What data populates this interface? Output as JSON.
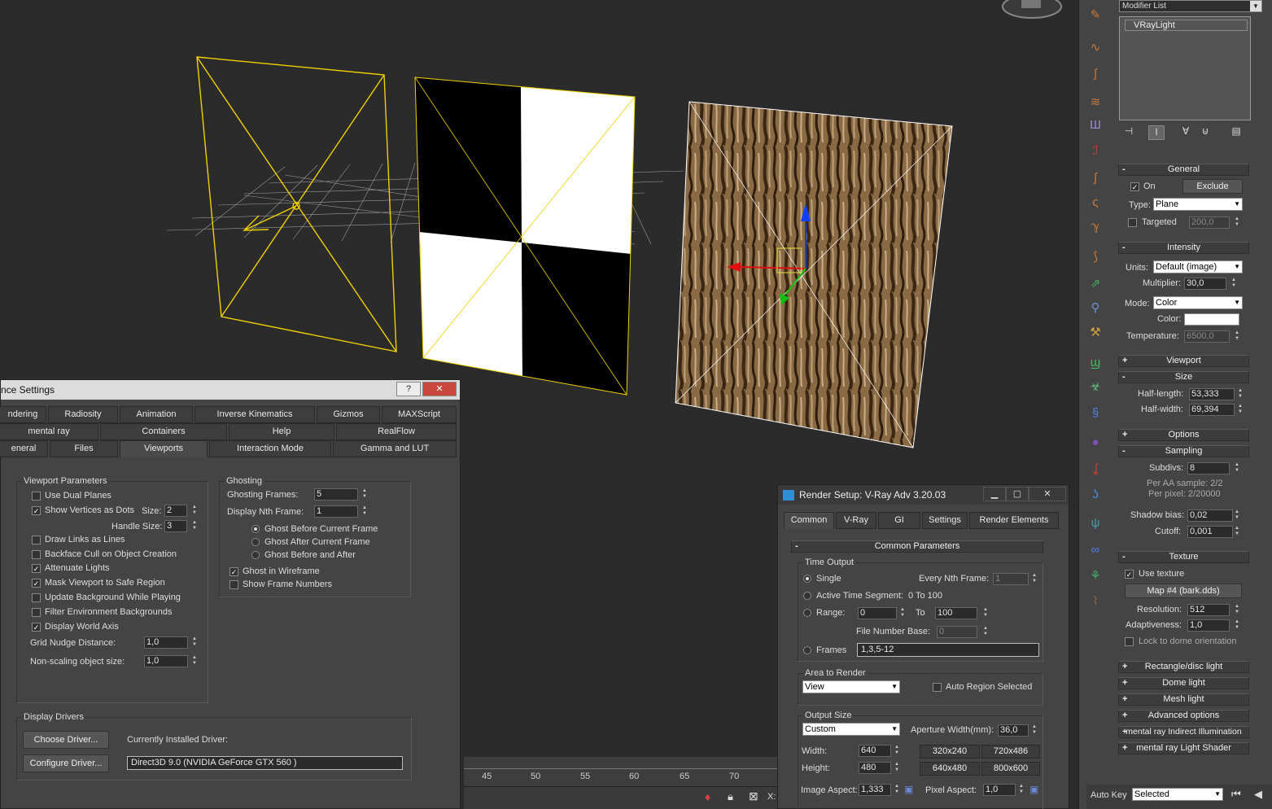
{
  "prefs": {
    "title": "nce Settings",
    "tabs_row1": [
      "ndering",
      "Radiosity",
      "Animation",
      "Inverse Kinematics",
      "Gizmos",
      "MAXScript"
    ],
    "tabs_row2": [
      "mental ray",
      "Containers",
      "Help",
      "RealFlow"
    ],
    "tabs_row3": [
      "eneral",
      "Files",
      "Viewports",
      "Interaction Mode",
      "Gamma and LUT"
    ],
    "viewport_params": {
      "title": "Viewport Parameters",
      "use_dual_planes": "Use Dual Planes",
      "show_vertices": "Show Vertices as Dots",
      "size_label": "Size:",
      "size_value": "2",
      "handle_size_label": "Handle Size:",
      "handle_size_value": "3",
      "draw_links": "Draw Links as Lines",
      "backface_cull": "Backface Cull on Object Creation",
      "attenuate_lights": "Attenuate Lights",
      "mask_viewport": "Mask Viewport to Safe Region",
      "update_background": "Update Background While Playing",
      "filter_env": "Filter Environment Backgrounds",
      "display_world_axis": "Display World Axis",
      "grid_nudge_label": "Grid Nudge Distance:",
      "grid_nudge_value": "1,0",
      "non_scaling_label": "Non-scaling object size:",
      "non_scaling_value": "1,0"
    },
    "ghosting": {
      "title": "Ghosting",
      "frames_label": "Ghosting Frames:",
      "frames_value": "5",
      "nth_label": "Display Nth Frame:",
      "nth_value": "1",
      "before": "Ghost Before Current Frame",
      "after": "Ghost After Current Frame",
      "both": "Ghost Before and After",
      "wireframe": "Ghost in Wireframe",
      "show_numbers": "Show Frame Numbers"
    },
    "display_drivers": {
      "title": "Display Drivers",
      "choose": "Choose Driver...",
      "configure": "Configure Driver...",
      "installed_label": "Currently Installed Driver:",
      "installed_value": "Direct3D 9.0 (NVIDIA GeForce GTX 560 )"
    }
  },
  "render": {
    "title": "Render Setup: V-Ray Adv 3.20.03",
    "tabs": [
      "Common",
      "V-Ray",
      "GI",
      "Settings",
      "Render Elements"
    ],
    "rollout": "Common Parameters",
    "time_output": {
      "title": "Time Output",
      "single": "Single",
      "every_nth": "Every Nth Frame:",
      "every_nth_value": "1",
      "active_segment": "Active Time Segment:",
      "active_segment_value": "0 To 100",
      "range": "Range:",
      "range_from": "0",
      "to": "To",
      "range_to": "100",
      "file_number_base": "File Number Base:",
      "file_number_base_value": "0",
      "frames": "Frames",
      "frames_value": "1,3,5-12"
    },
    "area": {
      "title": "Area to Render",
      "value": "View",
      "auto_region": "Auto Region Selected"
    },
    "output_size": {
      "title": "Output Size",
      "preset": "Custom",
      "aperture_label": "Aperture Width(mm):",
      "aperture_value": "36,0",
      "width_label": "Width:",
      "width_value": "640",
      "height_label": "Height:",
      "height_value": "480",
      "presets": [
        "320x240",
        "720x486",
        "640x480",
        "800x600"
      ],
      "image_aspect_label": "Image Aspect:",
      "image_aspect_value": "1,333",
      "pixel_aspect_label": "Pixel Aspect:",
      "pixel_aspect_value": "1,0"
    }
  },
  "cmdpanel": {
    "modifier_list": "Modifier List",
    "stack_item": "VRayLight",
    "general": {
      "title": "General",
      "on": "On",
      "exclude": "Exclude",
      "type_label": "Type:",
      "type_value": "Plane",
      "targeted": "Targeted",
      "targeted_value": "200,0"
    },
    "intensity": {
      "title": "Intensity",
      "units_label": "Units:",
      "units_value": "Default (image)",
      "multiplier_label": "Multiplier:",
      "multiplier_value": "30,0",
      "mode_label": "Mode:",
      "mode_value": "Color",
      "color_label": "Color:",
      "temperature_label": "Temperature:",
      "temperature_value": "6500,0"
    },
    "viewport_title": "Viewport",
    "size": {
      "title": "Size",
      "half_length_label": "Half-length:",
      "half_length_value": "53,333",
      "half_width_label": "Half-width:",
      "half_width_value": "69,394"
    },
    "options_title": "Options",
    "sampling": {
      "title": "Sampling",
      "subdivs_label": "Subdivs:",
      "subdivs_value": "8",
      "per_aa": "Per AA sample: 2/2",
      "per_pixel": "Per pixel: 2/20000",
      "shadow_bias_label": "Shadow bias:",
      "shadow_bias_value": "0,02",
      "cutoff_label": "Cutoff:",
      "cutoff_value": "0,001"
    },
    "texture": {
      "title": "Texture",
      "use_texture": "Use texture",
      "map": "Map #4 (bark.dds)",
      "resolution_label": "Resolution:",
      "resolution_value": "512",
      "adaptiveness_label": "Adaptiveness:",
      "adaptiveness_value": "1,0",
      "lock_dome": "Lock to dome orientation"
    },
    "collapsed": [
      "Rectangle/disc light",
      "Dome light",
      "Mesh light",
      "Advanced options",
      "mental ray Indirect Illumination",
      "mental ray Light Shader"
    ]
  },
  "timeline": {
    "ticks": [
      "45",
      "50",
      "55",
      "60",
      "65",
      "70"
    ]
  },
  "status": {
    "x_label": "X:",
    "auto_key": "Auto Key",
    "selected": "Selected"
  }
}
